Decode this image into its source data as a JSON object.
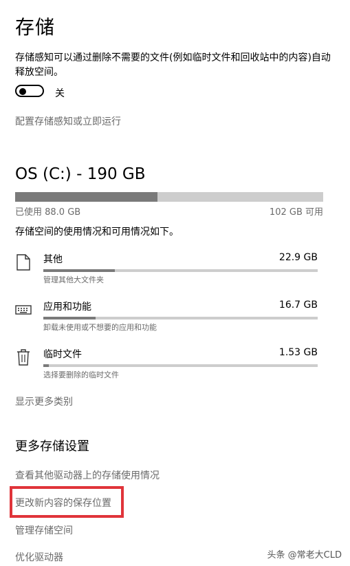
{
  "page": {
    "title": "存储",
    "storage_sense_desc": "存储感知可以通过删除不需要的文件(例如临时文件和回收站中的内容)自动释放空间。",
    "toggle_state_label": "关",
    "configure_link": "配置存储感知或立即运行"
  },
  "drive": {
    "title": "OS (C:) - 190 GB",
    "used_label": "已使用 88.0 GB",
    "free_label": "102 GB 可用",
    "used_fraction": 0.463,
    "usage_desc": "存储空间的使用情况和可用情况如下。"
  },
  "categories": [
    {
      "icon": "document-icon",
      "name": "其他",
      "size": "22.9 GB",
      "sub": "管理其他大文件夹",
      "fraction": 0.26
    },
    {
      "icon": "keyboard-icon",
      "name": "应用和功能",
      "size": "16.7 GB",
      "sub": "卸载未使用或不想要的应用和功能",
      "fraction": 0.19
    },
    {
      "icon": "trash-icon",
      "name": "临时文件",
      "size": "1.53 GB",
      "sub": "选择要删除的临时文件",
      "fraction": 0.02
    }
  ],
  "show_more_link": "显示更多类别",
  "more_settings": {
    "title": "更多存储设置",
    "links": [
      "查看其他驱动器上的存储使用情况",
      "更改新内容的保存位置",
      "管理存储空间",
      "优化驱动器"
    ]
  },
  "watermark": "头条 @常老大CLD",
  "colors": {
    "highlight": "#e0343a",
    "bar_used": "#7a7a7a",
    "bar_track": "#cdcdcd",
    "link": "#6a6a6a"
  }
}
